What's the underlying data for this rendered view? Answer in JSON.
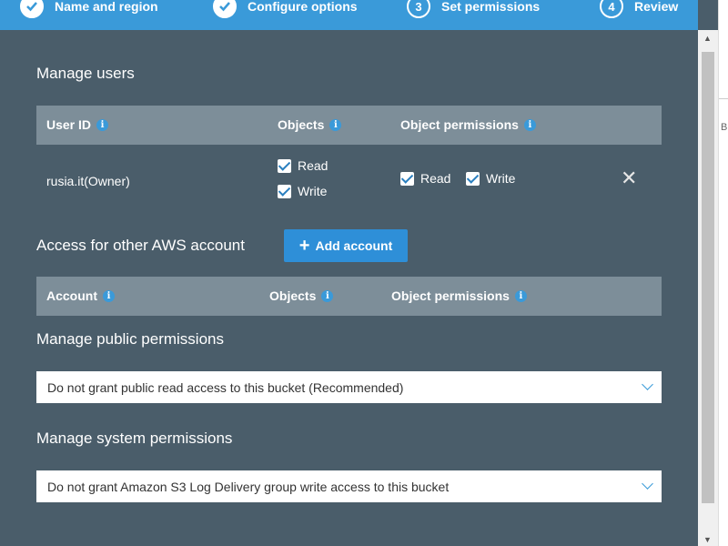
{
  "steps": [
    {
      "label": "Name and region",
      "marker": "check",
      "done": true
    },
    {
      "label": "Configure options",
      "marker": "check",
      "done": true
    },
    {
      "label": "Set permissions",
      "marker": "3",
      "done": false
    },
    {
      "label": "Review",
      "marker": "4",
      "done": false
    }
  ],
  "manage_users": {
    "heading": "Manage users",
    "columns": {
      "user_id": "User ID",
      "objects": "Objects",
      "object_permissions": "Object permissions"
    },
    "row": {
      "user": "rusia.it(Owner)",
      "objects": {
        "read": "Read",
        "write": "Write",
        "read_checked": true,
        "write_checked": true
      },
      "object_permissions": {
        "read": "Read",
        "write": "Write",
        "read_checked": true,
        "write_checked": true
      }
    }
  },
  "other_account": {
    "heading": "Access for other AWS account",
    "add_button": "Add account",
    "columns": {
      "account": "Account",
      "objects": "Objects",
      "object_permissions": "Object permissions"
    }
  },
  "public_permissions": {
    "heading": "Manage public permissions",
    "selected": "Do not grant public read access to this bucket (Recommended)"
  },
  "system_permissions": {
    "heading": "Manage system permissions",
    "selected": "Do not grant Amazon S3 Log Delivery group write access to this bucket"
  },
  "right_strip": {
    "partial_text": "B"
  },
  "colors": {
    "accent": "#3a9ad9",
    "panel_bg": "#4a5d6a",
    "table_header": "#7d8e99",
    "button": "#2e8fd8"
  }
}
